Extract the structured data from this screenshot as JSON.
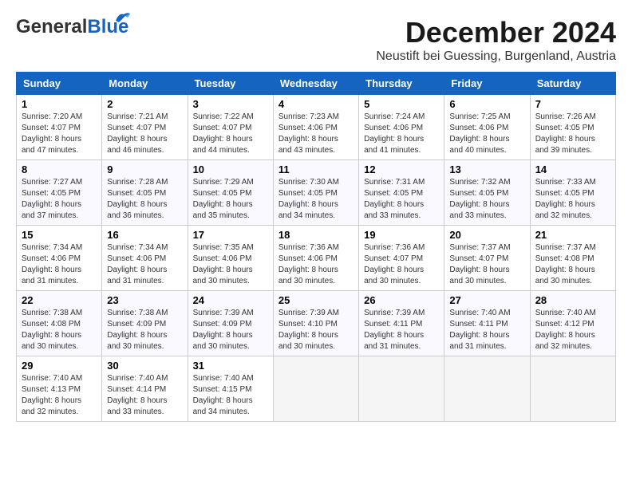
{
  "header": {
    "logo_general": "General",
    "logo_blue": "Blue",
    "month_title": "December 2024",
    "location": "Neustift bei Guessing, Burgenland, Austria"
  },
  "columns": [
    "Sunday",
    "Monday",
    "Tuesday",
    "Wednesday",
    "Thursday",
    "Friday",
    "Saturday"
  ],
  "weeks": [
    [
      {
        "day": "1",
        "sunrise": "7:20 AM",
        "sunset": "4:07 PM",
        "daylight": "8 hours and 47 minutes."
      },
      {
        "day": "2",
        "sunrise": "7:21 AM",
        "sunset": "4:07 PM",
        "daylight": "8 hours and 46 minutes."
      },
      {
        "day": "3",
        "sunrise": "7:22 AM",
        "sunset": "4:07 PM",
        "daylight": "8 hours and 44 minutes."
      },
      {
        "day": "4",
        "sunrise": "7:23 AM",
        "sunset": "4:06 PM",
        "daylight": "8 hours and 43 minutes."
      },
      {
        "day": "5",
        "sunrise": "7:24 AM",
        "sunset": "4:06 PM",
        "daylight": "8 hours and 41 minutes."
      },
      {
        "day": "6",
        "sunrise": "7:25 AM",
        "sunset": "4:06 PM",
        "daylight": "8 hours and 40 minutes."
      },
      {
        "day": "7",
        "sunrise": "7:26 AM",
        "sunset": "4:05 PM",
        "daylight": "8 hours and 39 minutes."
      }
    ],
    [
      {
        "day": "8",
        "sunrise": "7:27 AM",
        "sunset": "4:05 PM",
        "daylight": "8 hours and 37 minutes."
      },
      {
        "day": "9",
        "sunrise": "7:28 AM",
        "sunset": "4:05 PM",
        "daylight": "8 hours and 36 minutes."
      },
      {
        "day": "10",
        "sunrise": "7:29 AM",
        "sunset": "4:05 PM",
        "daylight": "8 hours and 35 minutes."
      },
      {
        "day": "11",
        "sunrise": "7:30 AM",
        "sunset": "4:05 PM",
        "daylight": "8 hours and 34 minutes."
      },
      {
        "day": "12",
        "sunrise": "7:31 AM",
        "sunset": "4:05 PM",
        "daylight": "8 hours and 33 minutes."
      },
      {
        "day": "13",
        "sunrise": "7:32 AM",
        "sunset": "4:05 PM",
        "daylight": "8 hours and 33 minutes."
      },
      {
        "day": "14",
        "sunrise": "7:33 AM",
        "sunset": "4:05 PM",
        "daylight": "8 hours and 32 minutes."
      }
    ],
    [
      {
        "day": "15",
        "sunrise": "7:34 AM",
        "sunset": "4:06 PM",
        "daylight": "8 hours and 31 minutes."
      },
      {
        "day": "16",
        "sunrise": "7:34 AM",
        "sunset": "4:06 PM",
        "daylight": "8 hours and 31 minutes."
      },
      {
        "day": "17",
        "sunrise": "7:35 AM",
        "sunset": "4:06 PM",
        "daylight": "8 hours and 30 minutes."
      },
      {
        "day": "18",
        "sunrise": "7:36 AM",
        "sunset": "4:06 PM",
        "daylight": "8 hours and 30 minutes."
      },
      {
        "day": "19",
        "sunrise": "7:36 AM",
        "sunset": "4:07 PM",
        "daylight": "8 hours and 30 minutes."
      },
      {
        "day": "20",
        "sunrise": "7:37 AM",
        "sunset": "4:07 PM",
        "daylight": "8 hours and 30 minutes."
      },
      {
        "day": "21",
        "sunrise": "7:37 AM",
        "sunset": "4:08 PM",
        "daylight": "8 hours and 30 minutes."
      }
    ],
    [
      {
        "day": "22",
        "sunrise": "7:38 AM",
        "sunset": "4:08 PM",
        "daylight": "8 hours and 30 minutes."
      },
      {
        "day": "23",
        "sunrise": "7:38 AM",
        "sunset": "4:09 PM",
        "daylight": "8 hours and 30 minutes."
      },
      {
        "day": "24",
        "sunrise": "7:39 AM",
        "sunset": "4:09 PM",
        "daylight": "8 hours and 30 minutes."
      },
      {
        "day": "25",
        "sunrise": "7:39 AM",
        "sunset": "4:10 PM",
        "daylight": "8 hours and 30 minutes."
      },
      {
        "day": "26",
        "sunrise": "7:39 AM",
        "sunset": "4:11 PM",
        "daylight": "8 hours and 31 minutes."
      },
      {
        "day": "27",
        "sunrise": "7:40 AM",
        "sunset": "4:11 PM",
        "daylight": "8 hours and 31 minutes."
      },
      {
        "day": "28",
        "sunrise": "7:40 AM",
        "sunset": "4:12 PM",
        "daylight": "8 hours and 32 minutes."
      }
    ],
    [
      {
        "day": "29",
        "sunrise": "7:40 AM",
        "sunset": "4:13 PM",
        "daylight": "8 hours and 32 minutes."
      },
      {
        "day": "30",
        "sunrise": "7:40 AM",
        "sunset": "4:14 PM",
        "daylight": "8 hours and 33 minutes."
      },
      {
        "day": "31",
        "sunrise": "7:40 AM",
        "sunset": "4:15 PM",
        "daylight": "8 hours and 34 minutes."
      },
      null,
      null,
      null,
      null
    ]
  ]
}
